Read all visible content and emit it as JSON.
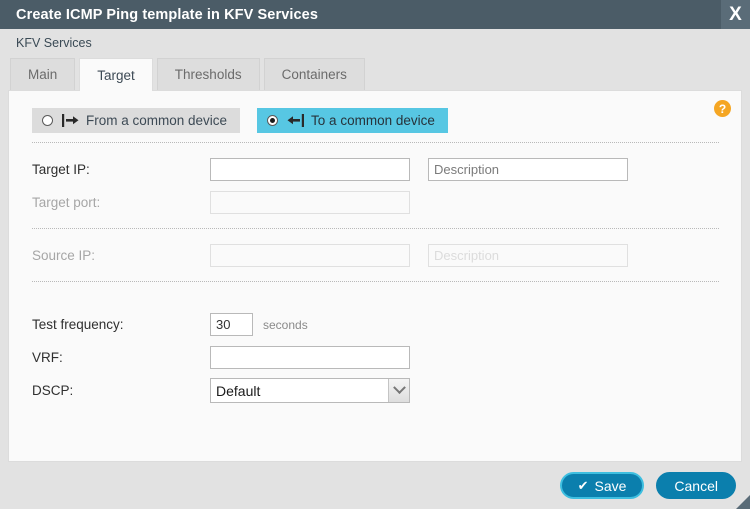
{
  "window": {
    "title": "Create ICMP Ping template in KFV Services",
    "close_label": "X",
    "breadcrumb": "KFV Services",
    "resize_grip": "resize-grip"
  },
  "tabs": [
    {
      "label": "Main",
      "active": false
    },
    {
      "label": "Target",
      "active": true
    },
    {
      "label": "Thresholds",
      "active": false
    },
    {
      "label": "Containers",
      "active": false
    }
  ],
  "help": {
    "label": "?"
  },
  "mode": {
    "options": [
      {
        "label": "From a common device",
        "selected": false,
        "icon": "bar-arrow-right-icon"
      },
      {
        "label": "To a common device",
        "selected": true,
        "icon": "bar-arrow-left-icon"
      }
    ]
  },
  "form": {
    "target_ip": {
      "label": "Target IP:",
      "value": "",
      "placeholder": "",
      "disabled": false,
      "description": {
        "value": "",
        "placeholder": "Description",
        "disabled": false
      }
    },
    "target_port": {
      "label": "Target port:",
      "value": "",
      "placeholder": "",
      "disabled": true
    },
    "source_ip": {
      "label": "Source IP:",
      "value": "",
      "placeholder": "",
      "disabled": true,
      "description": {
        "value": "",
        "placeholder": "Description",
        "disabled": true
      }
    },
    "test_frequency": {
      "label": "Test frequency:",
      "value": "30",
      "unit": "seconds"
    },
    "vrf": {
      "label": "VRF:",
      "value": "",
      "placeholder": ""
    },
    "dscp": {
      "label": "DSCP:",
      "value": "Default",
      "options": [
        "Default"
      ]
    }
  },
  "footer": {
    "save_label": "Save",
    "cancel_label": "Cancel"
  },
  "colors": {
    "titlebar": "#4b5c67",
    "accent_cyan": "#57c7e3",
    "button_blue": "#0b7fad",
    "help_orange": "#f5a623"
  }
}
